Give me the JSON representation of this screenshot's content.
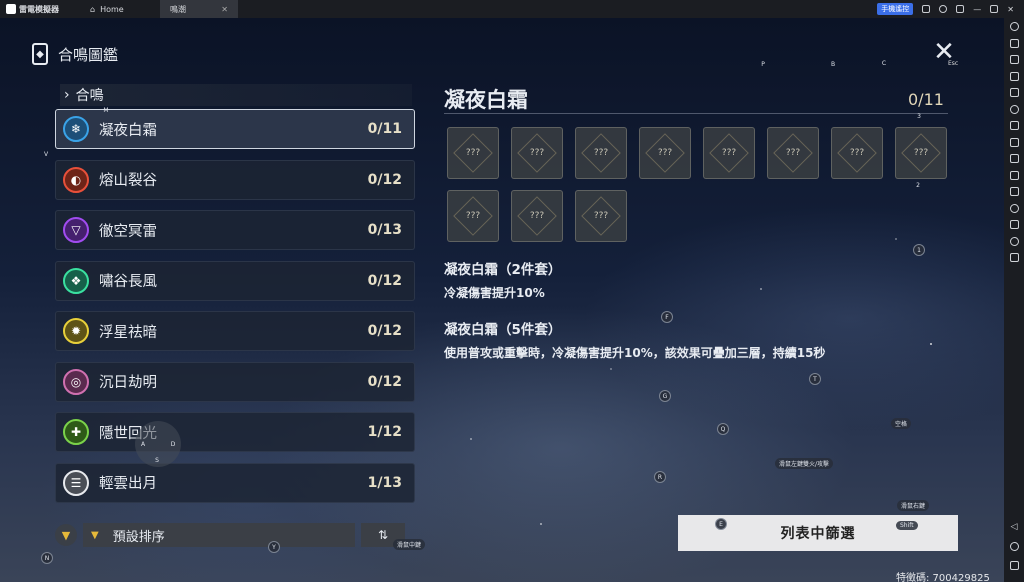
{
  "topbar": {
    "app_name": "雷電模擬器",
    "tabs": [
      {
        "label": "Home",
        "icon": "home-icon"
      },
      {
        "label": "鳴潮",
        "icon": "game-icon"
      }
    ],
    "remote_label": "手機遙控"
  },
  "page": {
    "title": "合鳴圖鑑",
    "close_hint": "Esc",
    "section": "合鳴"
  },
  "sets": [
    {
      "name": "凝夜白霜",
      "count": "0/11",
      "color": "#3aa3e8",
      "glyph": "❄",
      "selected": true
    },
    {
      "name": "熔山裂谷",
      "count": "0/12",
      "color": "#e8503a",
      "glyph": "◐",
      "selected": false
    },
    {
      "name": "徹空冥雷",
      "count": "0/13",
      "color": "#a14cf0",
      "glyph": "▽",
      "selected": false
    },
    {
      "name": "嘯谷長風",
      "count": "0/12",
      "color": "#3ae0a0",
      "glyph": "❖",
      "selected": false
    },
    {
      "name": "浮星祛暗",
      "count": "0/12",
      "color": "#e8d03a",
      "glyph": "✹",
      "selected": false
    },
    {
      "name": "沉日劫明",
      "count": "0/12",
      "color": "#d070b0",
      "glyph": "◎",
      "selected": false
    },
    {
      "name": "隱世回光",
      "count": "1/12",
      "color": "#7bd24a",
      "glyph": "✚",
      "selected": false
    },
    {
      "name": "輕雲出月",
      "count": "1/13",
      "color": "#e8eaee",
      "glyph": "☰",
      "selected": false
    }
  ],
  "sort": {
    "label": "預設排序",
    "order_icon": "sort-order-icon"
  },
  "detail": {
    "title": "凝夜白霜",
    "count": "0/11",
    "slots": [
      "???",
      "???",
      "???",
      "???",
      "???",
      "???",
      "???",
      "???",
      "???",
      "???",
      "???"
    ],
    "bonus2_title": "凝夜白霜（2件套）",
    "bonus2_desc": "冷凝傷害提升10%",
    "bonus5_title": "凝夜白霜（5件套）",
    "bonus5_desc": "使用普攻或重擊時，冷凝傷害提升10%，該效果可疊加三層，持續15秒",
    "filter_button": "列表中篩選"
  },
  "keymap": {
    "keys": [
      "P",
      "B",
      "C",
      "3",
      "M",
      "V",
      "2",
      "1",
      "F",
      "T",
      "G",
      "Q",
      "R",
      "E",
      "Y",
      "N",
      "A",
      "D",
      "S"
    ],
    "labels": [
      "空格",
      "滑鼠左鍵雙火/攻擊",
      "滑鼠右鍵",
      "Shift",
      "滑鼠中鍵"
    ]
  },
  "watermark": "特徵碼: 700429825"
}
